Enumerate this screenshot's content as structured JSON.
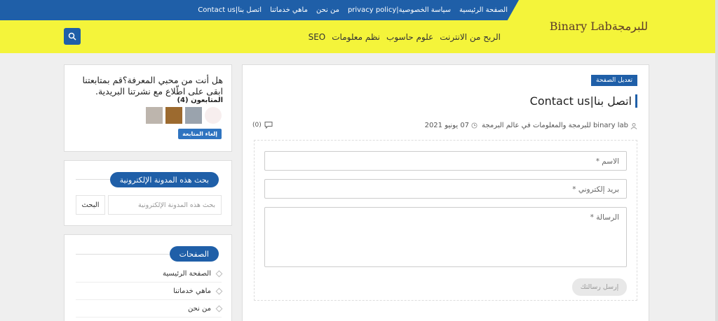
{
  "header": {
    "top_nav": [
      "الصفحة الرئيسية",
      "سياسة الخصوصية|privacy policy",
      "من نحن",
      "ماهي خدماتنا",
      "اتصل بنا|Contact us"
    ],
    "logo": "Binary Labللبرمجة",
    "main_nav": [
      "الربح من الانترنت",
      "علوم حاسوب",
      "نظم معلومات",
      "SEO"
    ],
    "colors": {
      "primary": "#1f5fa8",
      "accent": "#f4f43a"
    },
    "search_icon": "search-icon"
  },
  "follow_widget": {
    "text": "هل أنت من محبي المعرفة؟قم بمتابعتنا ابقى على اطّلاع مع نشرتنا البريدية.",
    "followers_label": "المتابعون (4)",
    "unfollow_label": "إلغاء المتابعة"
  },
  "search_widget": {
    "title": "بحث هذه المدونة الإلكترونية",
    "placeholder": "بحث هذه المدونة الإلكترونية",
    "button": "البحث"
  },
  "pages_widget": {
    "title": "الصفحات",
    "items": [
      "الصفحة الرئيسية",
      "ماهي خدماتنا",
      "من نحن"
    ]
  },
  "post": {
    "edit_label": "تعديل الصفحة",
    "title": "اتصل بنا|Contact us",
    "author": "binary lab للبرمجة والمعلومات في عالم البرمجة",
    "date": "07 يونيو 2021",
    "comments": "(0)"
  },
  "form": {
    "name_placeholder": "الاسم *",
    "email_placeholder": "بريد إلكتروني *",
    "message_placeholder": "الرسالة *",
    "send_label": "إرسل رسالتك"
  }
}
